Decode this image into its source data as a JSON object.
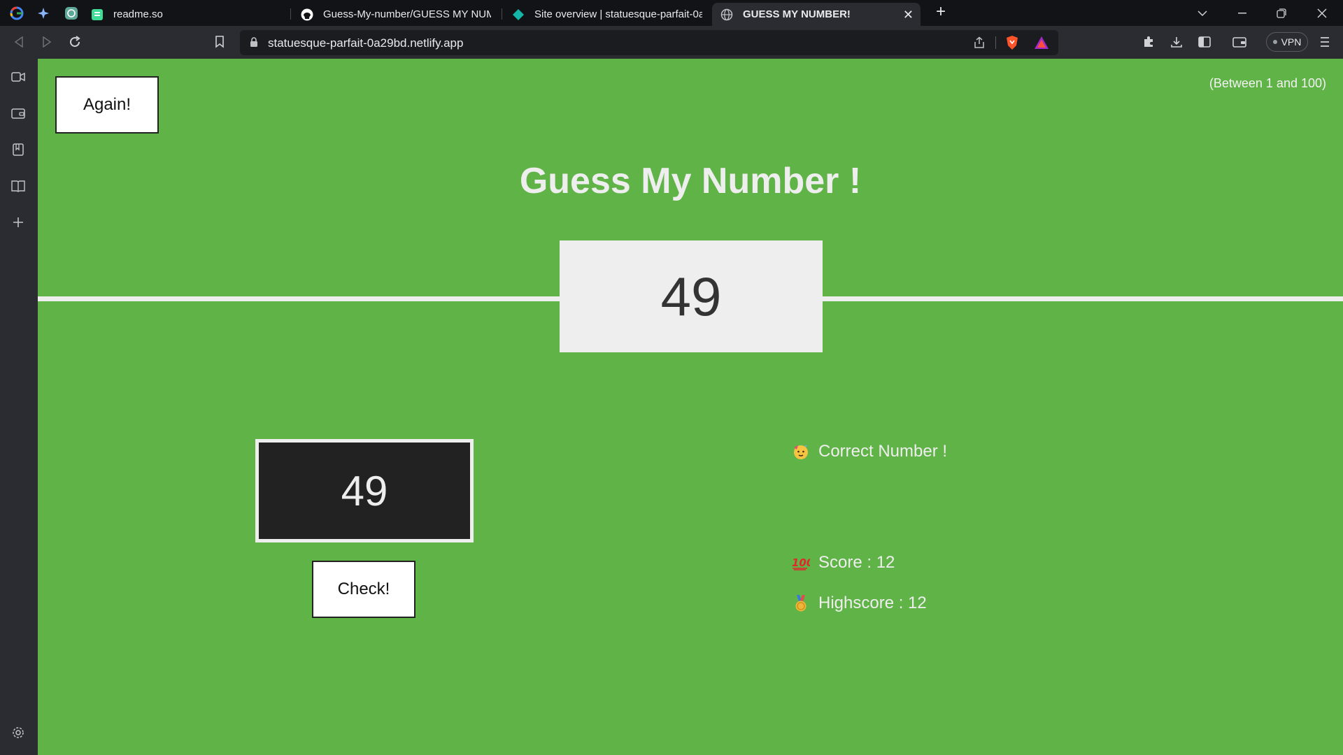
{
  "browser": {
    "tabs": [
      {
        "title": "readme.so",
        "icon": "readme-favicon"
      },
      {
        "title": "Guess-My-number/GUESS MY NUMBE",
        "icon": "github-icon"
      },
      {
        "title": "Site overview | statuesque-parfait-0a2",
        "icon": "netlify-icon"
      },
      {
        "title": "GUESS MY NUMBER!",
        "icon": "globe-icon"
      }
    ],
    "address": "statuesque-parfait-0a29bd.netlify.app",
    "vpn_label": "VPN"
  },
  "game": {
    "again_label": "Again!",
    "range_hint": "(Between 1 and 100)",
    "title": "Guess My Number !",
    "secret_number": "49",
    "guess_value": "49",
    "check_label": "Check!",
    "message": "Correct Number !",
    "score_text": "Score : 12",
    "highscore_text": "Highscore : 12"
  },
  "colors": {
    "page_background": "#60b347",
    "text": "#eeeeee",
    "input_background": "#222222"
  }
}
